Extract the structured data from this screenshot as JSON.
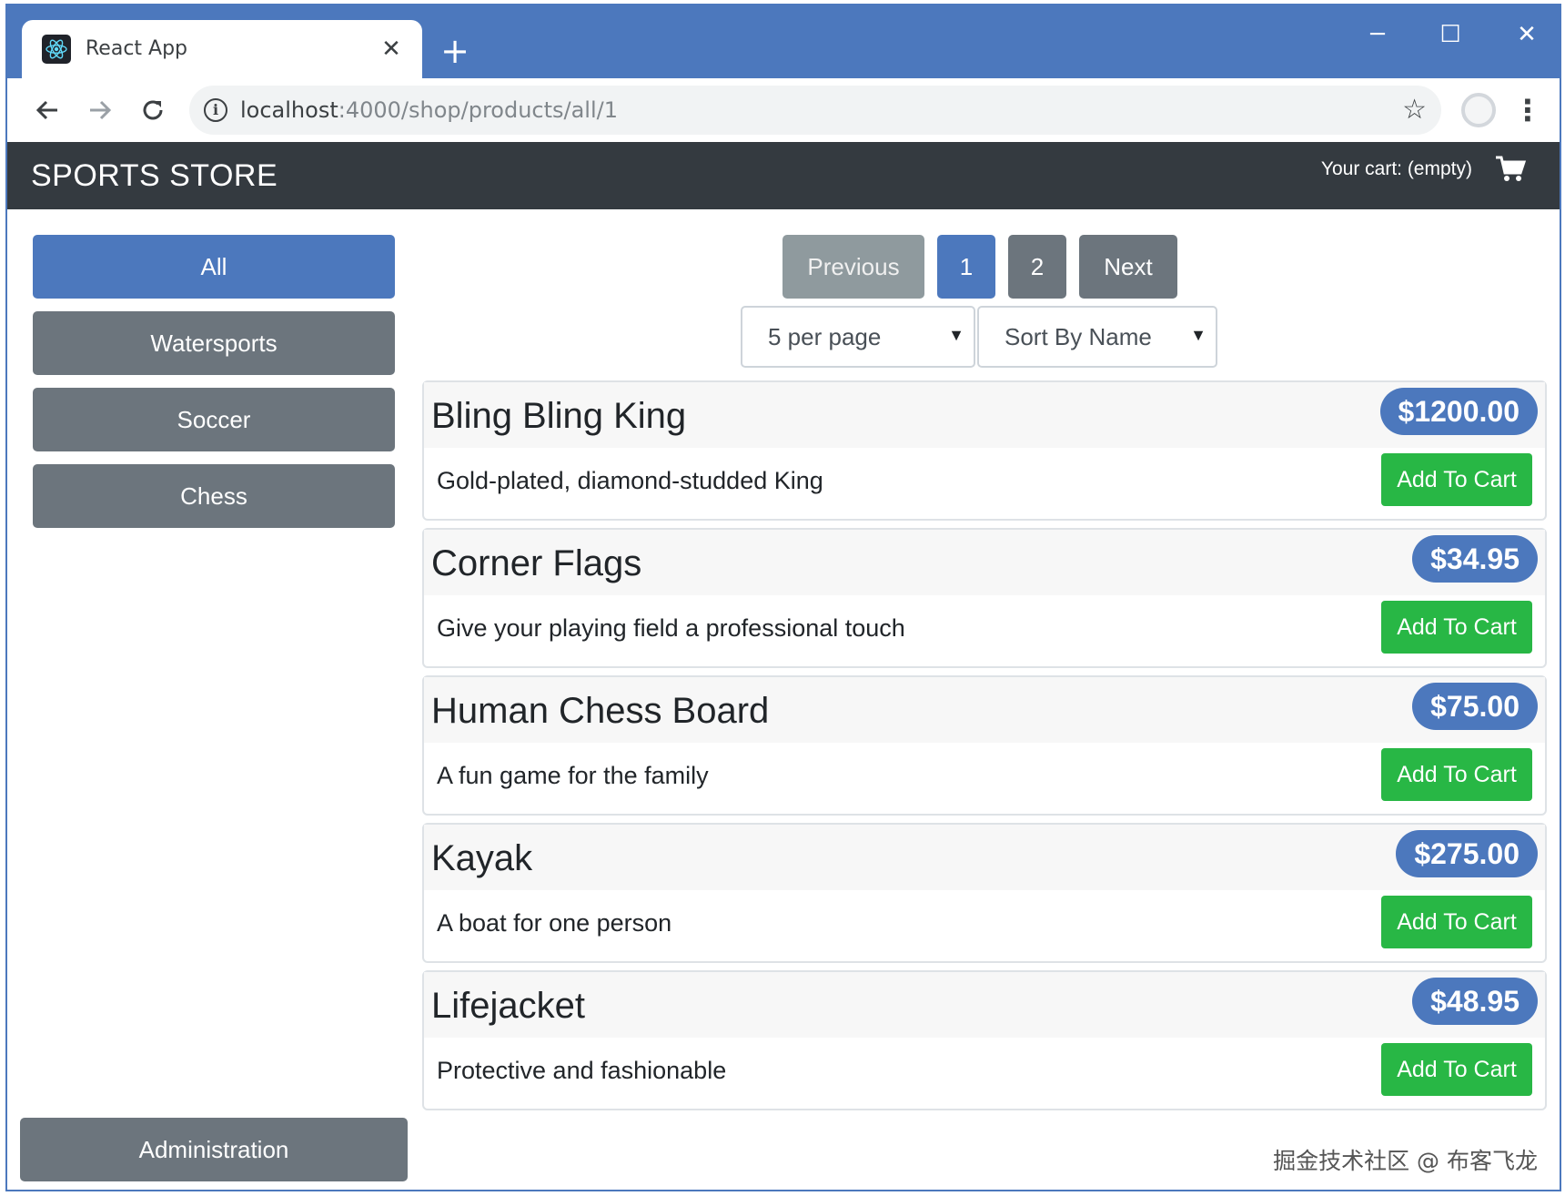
{
  "browser": {
    "tab_title": "React App",
    "tab_close": "✕",
    "new_tab": "+",
    "url_host": "localhost",
    "url_rest": ":4000/shop/products/all/1",
    "window_controls": {
      "minimize": "─",
      "maximize": "☐",
      "close": "✕"
    },
    "accent_color": "#4c78bd"
  },
  "header": {
    "brand": "SPORTS STORE",
    "cart_text": "Your cart: (empty)"
  },
  "sidebar": {
    "categories": [
      {
        "label": "All",
        "active": true
      },
      {
        "label": "Watersports",
        "active": false
      },
      {
        "label": "Soccer",
        "active": false
      },
      {
        "label": "Chess",
        "active": false
      }
    ],
    "admin_label": "Administration"
  },
  "pagination": {
    "previous_label": "Previous",
    "pages": [
      "1",
      "2"
    ],
    "current_page": "1",
    "next_label": "Next"
  },
  "controls": {
    "page_size": "5 per page",
    "sort": "Sort By Name"
  },
  "products": [
    {
      "name": "Bling Bling King",
      "price": "$1200.00",
      "description": "Gold-plated, diamond-studded King",
      "button": "Add To Cart"
    },
    {
      "name": "Corner Flags",
      "price": "$34.95",
      "description": "Give your playing field a professional touch",
      "button": "Add To Cart"
    },
    {
      "name": "Human Chess Board",
      "price": "$75.00",
      "description": "A fun game for the family",
      "button": "Add To Cart"
    },
    {
      "name": "Kayak",
      "price": "$275.00",
      "description": "A boat for one person",
      "button": "Add To Cart"
    },
    {
      "name": "Lifejacket",
      "price": "$48.95",
      "description": "Protective and fashionable",
      "button": "Add To Cart"
    }
  ],
  "watermark": "掘金技术社区 @ 布客飞龙",
  "colors": {
    "primary": "#4c78bd",
    "secondary": "#6c757d",
    "success": "#28b745",
    "dark": "#343a40"
  },
  "icons": {
    "back": "back-arrow-icon",
    "forward": "forward-arrow-icon",
    "reload": "reload-icon",
    "info": "info-icon",
    "star": "star-icon",
    "profile": "profile-icon",
    "menu": "kebab-menu-icon",
    "cart": "shopping-cart-icon"
  }
}
